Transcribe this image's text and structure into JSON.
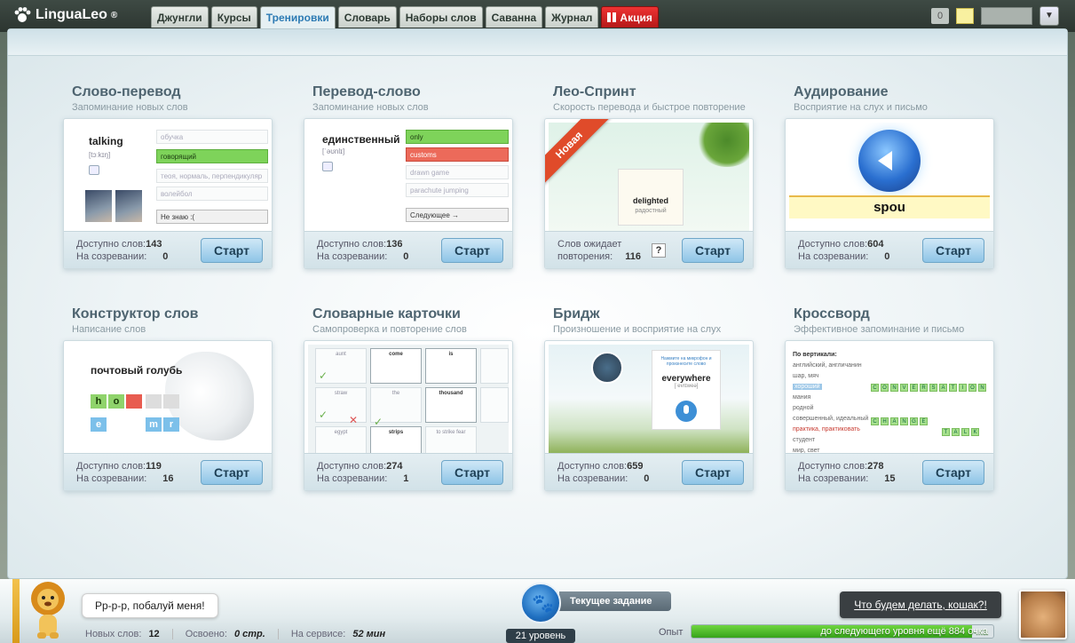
{
  "app": {
    "logo": "LinguaLeo",
    "logo_mark": "®"
  },
  "nav": {
    "tabs": [
      {
        "label": "Джунгли"
      },
      {
        "label": "Курсы"
      },
      {
        "label": "Тренировки"
      },
      {
        "label": "Словарь"
      },
      {
        "label": "Наборы слов"
      },
      {
        "label": "Саванна"
      },
      {
        "label": "Журнал"
      },
      {
        "label": "Акция"
      }
    ],
    "active_tab": "Тренировки"
  },
  "top_right": {
    "messages_count": "0"
  },
  "labels": {
    "available": "Доступно слов:",
    "ripening": "На созревании:",
    "start": "Старт",
    "awaiting_1": "Слов ожидает",
    "awaiting_2": "повторения:"
  },
  "cards": [
    {
      "title": "Слово-перевод",
      "subtitle": "Запоминание новых слов",
      "available": "143",
      "ripening": "0",
      "preview": {
        "word": "talking",
        "transcription": "[tɔːkɪŋ]",
        "options": [
          "обучка",
          "говорящий",
          "теоя, нормаль, перпендикуляр",
          "волейбол",
          "Не знаю :("
        ]
      }
    },
    {
      "title": "Перевод-слово",
      "subtitle": "Запоминание новых слов",
      "available": "136",
      "ripening": "0",
      "preview": {
        "word": "единственный",
        "transcription": "[ˈəʊnlɪ]",
        "options": [
          "only",
          "customs",
          "drawn game",
          "parachute jumping",
          "Следующее →"
        ]
      }
    },
    {
      "title": "Лео-Спринт",
      "subtitle": "Скорость перевода и быстрое повторение",
      "awaiting": "116",
      "badge": "Новая",
      "help": "?",
      "preview": {
        "word": "delighted",
        "translation": "радостный"
      }
    },
    {
      "title": "Аудирование",
      "subtitle": "Восприятие на слух и письмо",
      "available": "604",
      "ripening": "0",
      "preview": {
        "typed": "spou"
      }
    },
    {
      "title": "Конструктор слов",
      "subtitle": "Написание слов",
      "available": "119",
      "ripening": "16",
      "preview": {
        "phrase": "почтовый голубь",
        "letters": [
          "h",
          "o",
          "e",
          "m",
          "r"
        ]
      }
    },
    {
      "title": "Словарные карточки",
      "subtitle": "Самопроверка и повторение слов",
      "available": "274",
      "ripening": "1",
      "preview": {
        "words": [
          "aunt",
          "come",
          "is",
          "straw",
          "the",
          "thousand",
          "egypt",
          "strips",
          "to strike fear"
        ]
      }
    },
    {
      "title": "Бридж",
      "subtitle": "Произношение и восприятие на слух",
      "available": "659",
      "ripening": "0",
      "preview": {
        "hint": "Нажмите на микрофон и произнесите слово",
        "word": "everywhere",
        "transcription": "[ˈevrɪweə]"
      }
    },
    {
      "title": "Кроссворд",
      "subtitle": "Эффективное запоминание и письмо",
      "available": "278",
      "ripening": "15",
      "preview": {
        "heading": "По вертикали:",
        "clues": [
          "английский, англичанин",
          "шар, мяч",
          "хороший",
          "мания",
          "родной",
          "совершенный, идеальный",
          "практика, практиковать",
          "студент",
          "мир, свет"
        ],
        "words": [
          "CONVERSATION",
          "CHANGE",
          "TALK"
        ]
      }
    }
  ],
  "bottom": {
    "lion_speech": "Рр-р-р, побалуй меня!",
    "new_words_label": "Новых слов:",
    "new_words": "12",
    "learned_label": "Освоено:",
    "learned": "0 стр.",
    "online_label": "На сервисе:",
    "online": "52 мин",
    "task_label": "Текущее задание",
    "level": "21 уровень",
    "what_to_do": "Что будем делать, кошак?!",
    "xp_label": "Опыт",
    "xp_text": "до следующего уровня ещё 884 очка",
    "xp_progress": 0.93
  }
}
